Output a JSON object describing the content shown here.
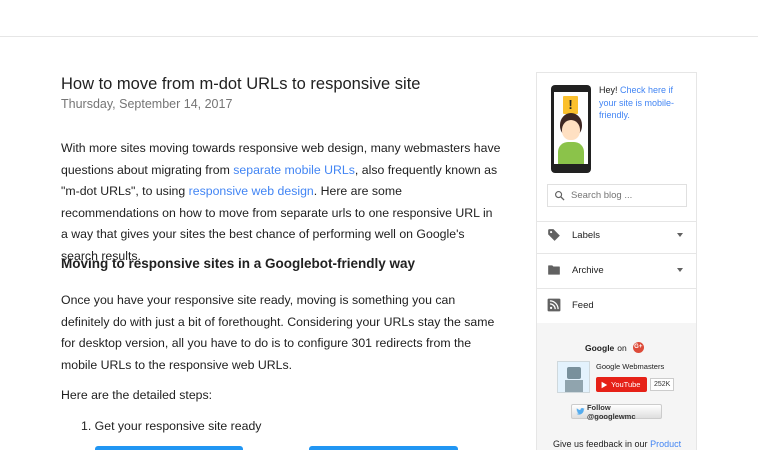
{
  "post": {
    "title": "How to move from m-dot URLs to responsive site",
    "date": "Thursday, September 14, 2017",
    "p1_a": "With more sites moving towards responsive web design, many webmasters have questions about migrating from ",
    "p1_link1": "separate mobile URLs",
    "p1_b": ", also frequently known as \"m-dot URLs\", to using ",
    "p1_link2": "responsive web design",
    "p1_c": ". Here are some recommendations on how to move from separate urls to one responsive URL in a way that gives your sites the best chance of performing well on Google's search results.",
    "heading": "Moving to responsive sites in a Googlebot-friendly way",
    "p2": "Once you have your responsive site ready, moving is something you can definitely do with just a bit of forethought. Considering your URLs stay the same for desktop version, all you have to do is to configure 301 redirects from the mobile URLs to the responsive web URLs.",
    "p3": "Here are the detailed steps:",
    "step1": "1. Get your responsive site ready"
  },
  "sidebar": {
    "hey": "Hey! ",
    "check_link": "Check here if your site is mobile-friendly.",
    "search_placeholder": "Search blog ...",
    "labels": "Labels",
    "archive": "Archive",
    "feed": "Feed",
    "google_on_bold": "Google",
    "google_on_text": "on",
    "gplus": "G+",
    "gw_name": "Google Webmasters",
    "youtube": "YouTube",
    "yt_count": "252K",
    "twitter": "Follow @googlewmc",
    "feedback_text": "Give us feedback in our ",
    "feedback_link": "Product"
  },
  "colors": {
    "link": "#4285f4",
    "youtube_red": "#e62117",
    "accent_blue": "#2196f3"
  }
}
